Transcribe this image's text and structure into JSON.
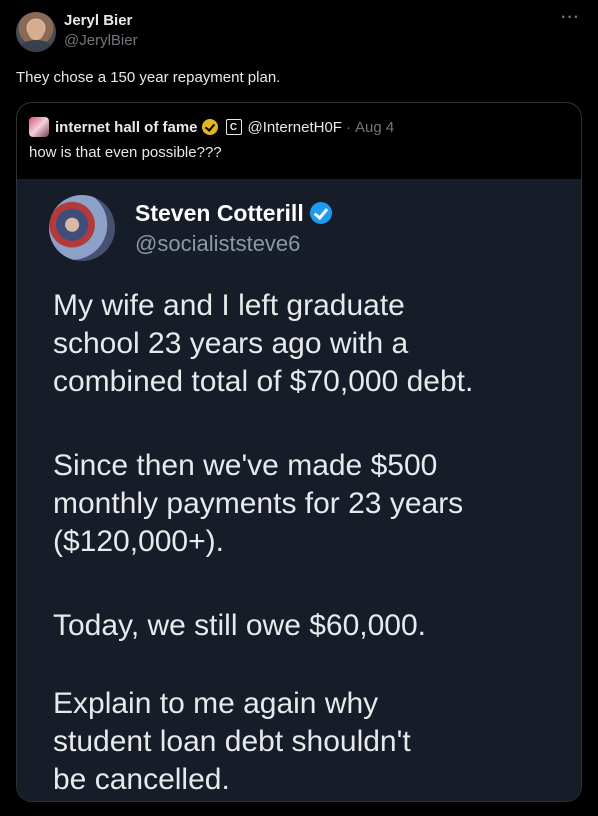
{
  "tweet": {
    "display_name": "Jeryl Bier",
    "handle": "@JerylBier",
    "more_label": "···",
    "text": "They chose a 150 year repayment plan."
  },
  "quote": {
    "display_name": "internet hall of fame",
    "handle": "@InternetH0F",
    "separator": "·",
    "date": "Aug 4",
    "badge_letter": "C",
    "text": "how is that even possible???"
  },
  "media": {
    "display_name": "Steven Cotterill",
    "handle": "@socialiststeve6",
    "paragraph1": [
      "My wife and I left graduate",
      "school 23 years ago with a",
      "combined total of $70,000 debt."
    ],
    "paragraph2": [
      "Since then we've made $500",
      "monthly payments for 23 years",
      "($120,000+)."
    ],
    "paragraph3": [
      "Today, we still owe $60,000."
    ],
    "paragraph4": [
      "Explain to me again why",
      "student loan debt shouldn't",
      "be cancelled."
    ]
  },
  "colors": {
    "background": "#000000",
    "text": "#e7e9ea",
    "secondary": "#71767b",
    "verified_blue": "#1d9bf0",
    "verified_gold": "#e2b719",
    "media_bg": "#161c28"
  }
}
